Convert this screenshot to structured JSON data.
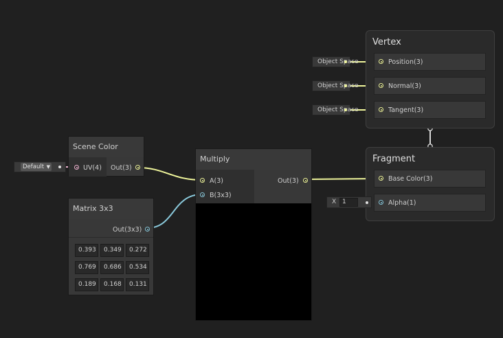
{
  "scene_color": {
    "title": "Scene Color",
    "input_label": "UV(4)",
    "output_label": "Out(3)",
    "default_dropdown": "Default"
  },
  "matrix": {
    "title": "Matrix 3x3",
    "output_label": "Out(3x3)",
    "values": [
      [
        "0.393",
        "0.349",
        "0.272"
      ],
      [
        "0.769",
        "0.686",
        "0.534"
      ],
      [
        "0.189",
        "0.168",
        "0.131"
      ]
    ]
  },
  "multiply": {
    "title": "Multiply",
    "input_a": "A(3)",
    "input_b": "B(3x3)",
    "output_label": "Out(3)"
  },
  "vertex": {
    "title": "Vertex",
    "slots": [
      {
        "label": "Position(3)",
        "space": "Object Space"
      },
      {
        "label": "Normal(3)",
        "space": "Object Space"
      },
      {
        "label": "Tangent(3)",
        "space": "Object Space"
      }
    ]
  },
  "fragment": {
    "title": "Fragment",
    "base_color_label": "Base Color(3)",
    "alpha_label": "Alpha(1)",
    "alpha_field_label": "X",
    "alpha_value": "1"
  },
  "colors": {
    "canvas": "#202020",
    "vector3_wire": "#f1f79c",
    "matrix_wire": "#8ac9db",
    "vector4_port": "#f0b5d2"
  }
}
